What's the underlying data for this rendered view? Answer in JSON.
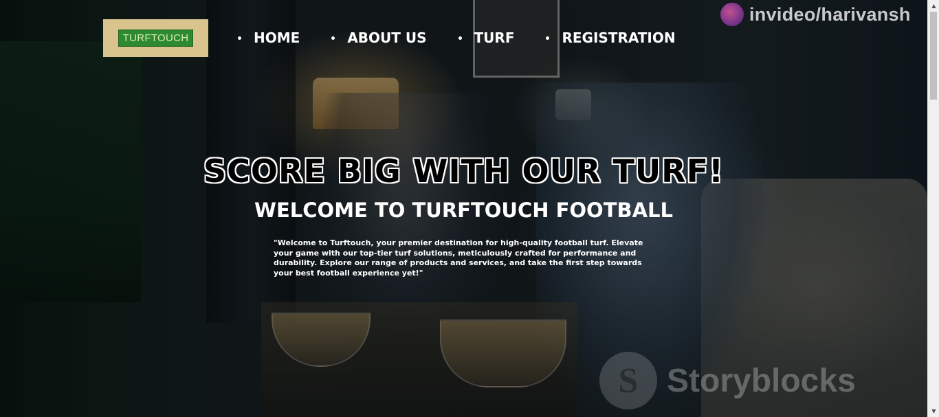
{
  "logo": {
    "text": "TURFTOUCH"
  },
  "nav": {
    "items": [
      {
        "label": "HOME"
      },
      {
        "label": "ABOUT US"
      },
      {
        "label": "TURF"
      },
      {
        "label": "REGISTRATION"
      }
    ]
  },
  "hero": {
    "title": "SCORE BIG WITH OUR TURF!",
    "subtitle": "WELCOME TO TURFTOUCH FOOTBALL",
    "text": "\"Welcome to Turftouch, your premier destination for high-quality football turf. Elevate your game with our top-tier turf solutions, meticulously crafted for performance and durability. Explore our range of products and services, and take the first step towards your best football experience yet!\""
  },
  "watermarks": {
    "invideo": "invideo/harivansh",
    "storyblocks": "Storyblocks"
  },
  "scrollbar": {
    "up_icon": "▲",
    "down_icon": "▼"
  }
}
